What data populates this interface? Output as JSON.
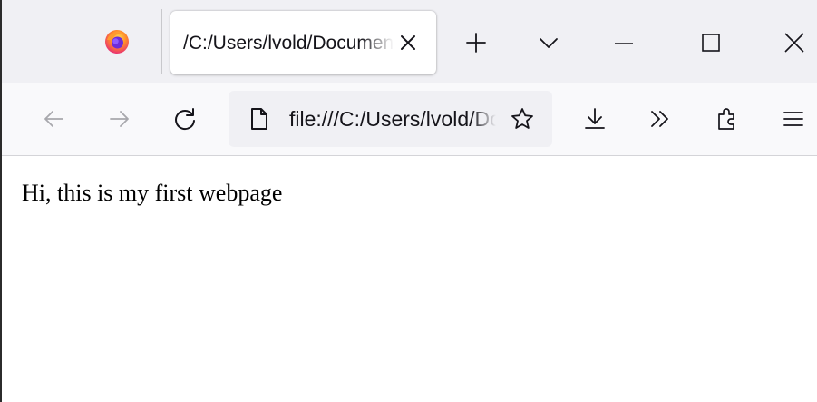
{
  "tab": {
    "title": "/C:/Users/lvold/Documents/webpage.html"
  },
  "urlbar": {
    "value": "file:///C:/Users/lvold/Documents/webpage.html"
  },
  "page": {
    "text": "Hi, this is my first webpage"
  },
  "icons": {
    "app_logo": "firefox-logo-icon",
    "tab_close": "close-icon",
    "new_tab": "plus-icon",
    "tab_list": "chevron-down-icon",
    "minimize": "minimize-icon",
    "maximize": "maximize-icon",
    "close_window": "close-icon",
    "back": "arrow-left-icon",
    "forward": "arrow-right-icon",
    "reload": "reload-icon",
    "page_info": "document-icon",
    "bookmark": "star-icon",
    "downloads": "download-icon",
    "overflow": "chevrons-right-icon",
    "extensions": "puzzle-icon",
    "menu": "hamburger-menu-icon"
  },
  "colors": {
    "tabstrip_bg": "#f0f0f4",
    "navbar_bg": "#f9f9fb",
    "urlbar_bg": "#f0f0f4",
    "disabled_icon": "#a8a8ad",
    "icon": "#15141a"
  }
}
